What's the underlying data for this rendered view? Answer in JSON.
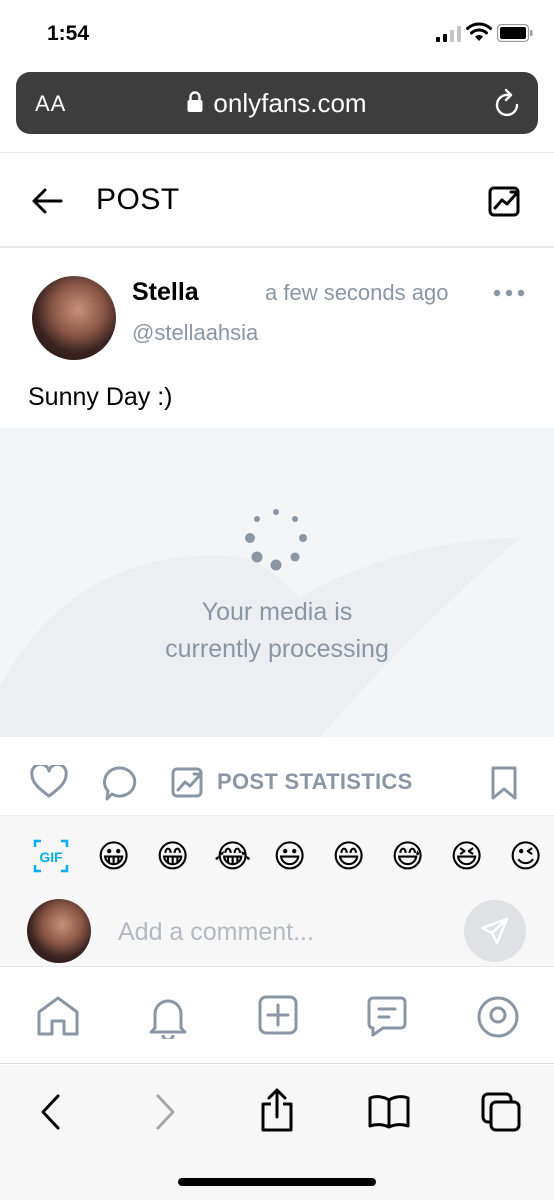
{
  "status_bar": {
    "time": "1:54"
  },
  "browser": {
    "text_size_label": "AA",
    "url": "onlyfans.com"
  },
  "header": {
    "title": "POST"
  },
  "post": {
    "author_name": "Stella",
    "author_handle": "@stellaahsia",
    "timestamp": "a few seconds ago",
    "text": "Sunny Day :)",
    "media_status_line1": "Your media is",
    "media_status_line2": "currently processing"
  },
  "actions": {
    "statistics_label": "POST STATISTICS"
  },
  "emoji_bar": {
    "gif_label": "GIF",
    "emojis": [
      "😀",
      "😁",
      "😂",
      "😃",
      "😄",
      "😅",
      "😆",
      "😉"
    ]
  },
  "comment": {
    "placeholder": "Add a comment..."
  },
  "colors": {
    "muted": "#8a96a3",
    "url_bar": "#3d3d3d",
    "accent": "#00aff0"
  }
}
